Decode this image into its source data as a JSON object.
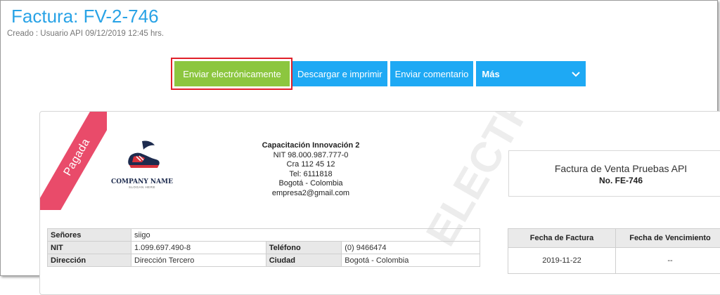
{
  "header": {
    "title": "Factura: FV-2-746",
    "created": "Creado :  Usuario API 09/12/2019 12:45 hrs."
  },
  "toolbar": {
    "send_label": "Enviar electrónicamente",
    "download_label": "Descargar e imprimir",
    "comment_label": "Enviar comentario",
    "more_label": "Más",
    "more_icon": "chevron-down-icon"
  },
  "document": {
    "status_ribbon": "Pagada",
    "logo": {
      "company_name": "COMPANY NAME",
      "slogan": "SLOGAN HERE"
    },
    "company": {
      "name": "Capacitación Innovación 2",
      "nit": "NIT 98.000.987.777-0",
      "address": "Cra 112 45 12",
      "phone": "Tel: 6111818",
      "city": "Bogotá - Colombia",
      "email": "empresa2@gmail.com"
    },
    "watermark": "ELECTRÓNICA",
    "invoice": {
      "title": "Factura de Venta Pruebas API",
      "number": "No. FE-746"
    },
    "client": {
      "senores_label": "Señores",
      "senores_value": "siigo",
      "nit_label": "NIT",
      "nit_value": "1.099.697.490-8",
      "telefono_label": "Teléfono",
      "telefono_value": "(0) 9466474",
      "direccion_label": "Dirección",
      "direccion_value": "Dirección Tercero",
      "ciudad_label": "Ciudad",
      "ciudad_value": "Bogotá - Colombia"
    },
    "dates": {
      "invoice_date_label": "Fecha de Factura",
      "due_date_label": "Fecha de Vencimiento",
      "invoice_date": "2019-11-22",
      "due_date": "--"
    }
  },
  "colors": {
    "title_blue": "#29a3e6",
    "button_green": "#8cc63f",
    "button_blue": "#1ea9f4",
    "highlight_red": "#e0202a",
    "ribbon_pink": "#e94b6a"
  }
}
